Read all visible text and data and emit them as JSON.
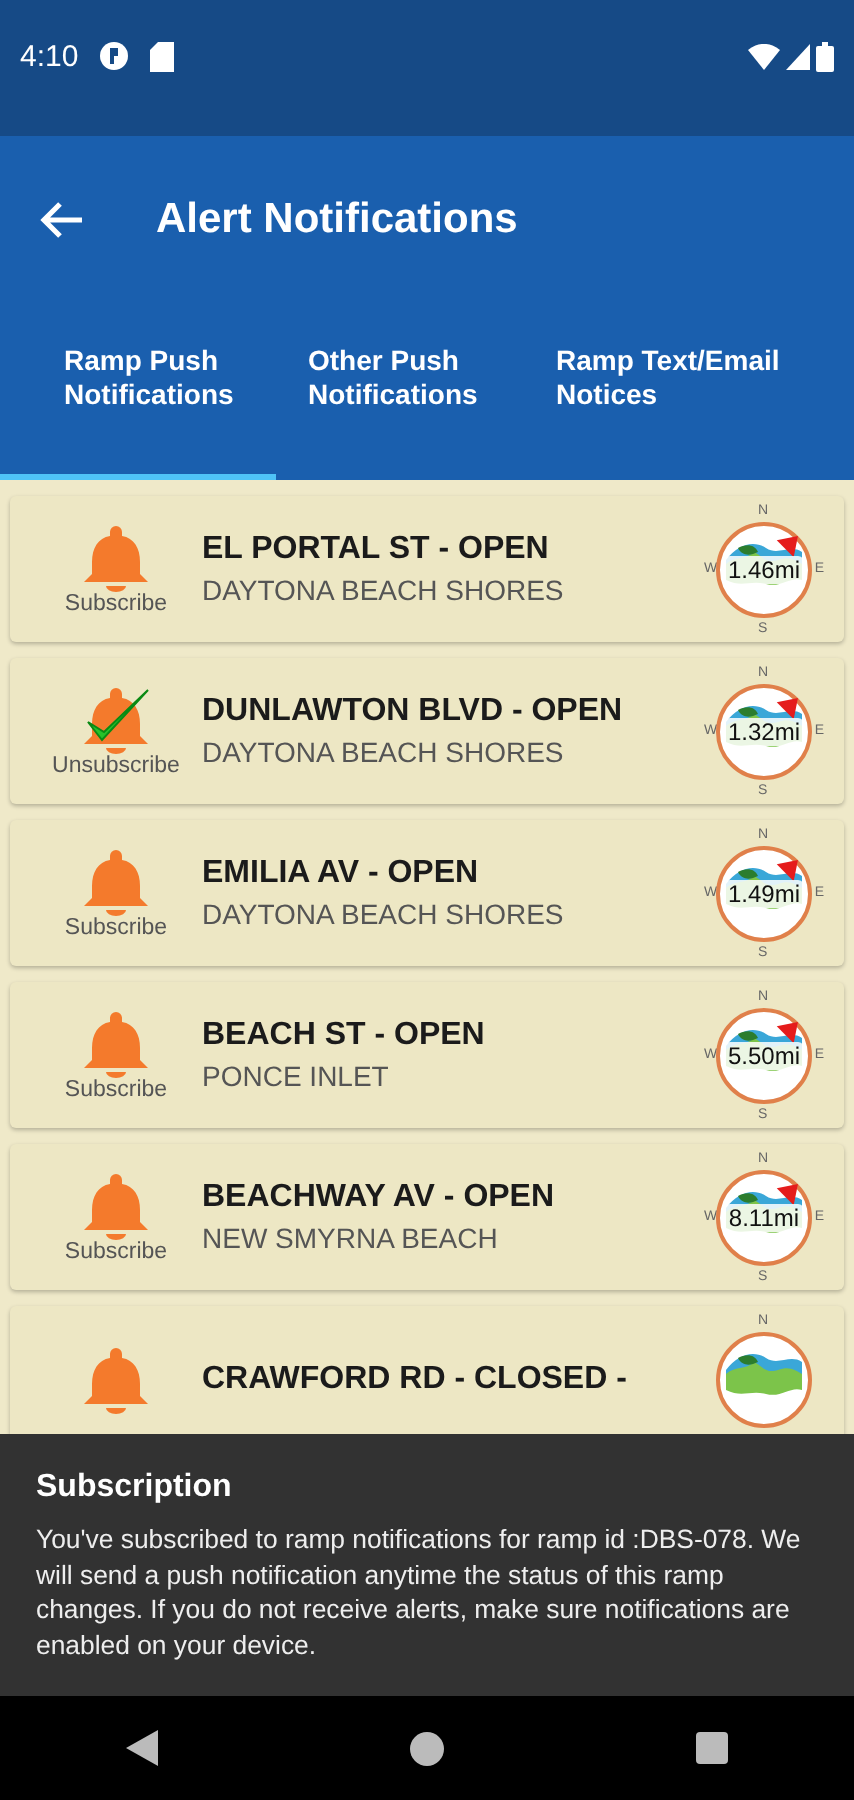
{
  "status_bar": {
    "time": "4:10"
  },
  "app_bar": {
    "title": "Alert Notifications"
  },
  "tabs": [
    {
      "label": "Ramp Push Notifications",
      "selected": true
    },
    {
      "label": "Other Push Notifications",
      "selected": false
    },
    {
      "label": "Ramp Text/Email Notices",
      "selected": false
    }
  ],
  "ramps": [
    {
      "action": "Subscribe",
      "subscribed": false,
      "title": "EL PORTAL ST - OPEN",
      "area": "DAYTONA BEACH SHORES",
      "distance": "1.46mi",
      "compass": {
        "n": "N",
        "w": "W",
        "e": "E",
        "s": "S"
      }
    },
    {
      "action": "Unsubscribe",
      "subscribed": true,
      "title": "DUNLAWTON BLVD - OPEN",
      "area": "DAYTONA BEACH SHORES",
      "distance": "1.32mi",
      "compass": {
        "n": "N",
        "w": "W",
        "e": "E",
        "s": "S"
      }
    },
    {
      "action": "Subscribe",
      "subscribed": false,
      "title": "EMILIA AV - OPEN",
      "area": "DAYTONA BEACH SHORES",
      "distance": "1.49mi",
      "compass": {
        "n": "N",
        "w": "W",
        "e": "E",
        "s": "S"
      }
    },
    {
      "action": "Subscribe",
      "subscribed": false,
      "title": "BEACH ST - OPEN",
      "area": "PONCE INLET",
      "distance": "5.50mi",
      "compass": {
        "n": "N",
        "w": "W",
        "e": "E",
        "s": "S"
      }
    },
    {
      "action": "Subscribe",
      "subscribed": false,
      "title": "BEACHWAY AV - OPEN",
      "area": "NEW SMYRNA BEACH",
      "distance": "8.11mi",
      "compass": {
        "n": "N",
        "w": "W",
        "e": "E",
        "s": "S"
      }
    },
    {
      "subscribed": false,
      "title": "CRAWFORD RD - CLOSED -",
      "compass": {
        "n": "N"
      }
    }
  ],
  "snackbar": {
    "title": "Subscription",
    "message": "You've subscribed to ramp notifications for ramp id :DBS-078.  We will send a push notification anytime the status of this ramp changes.  If you do not receive alerts, make sure notifications are enabled on your device."
  }
}
